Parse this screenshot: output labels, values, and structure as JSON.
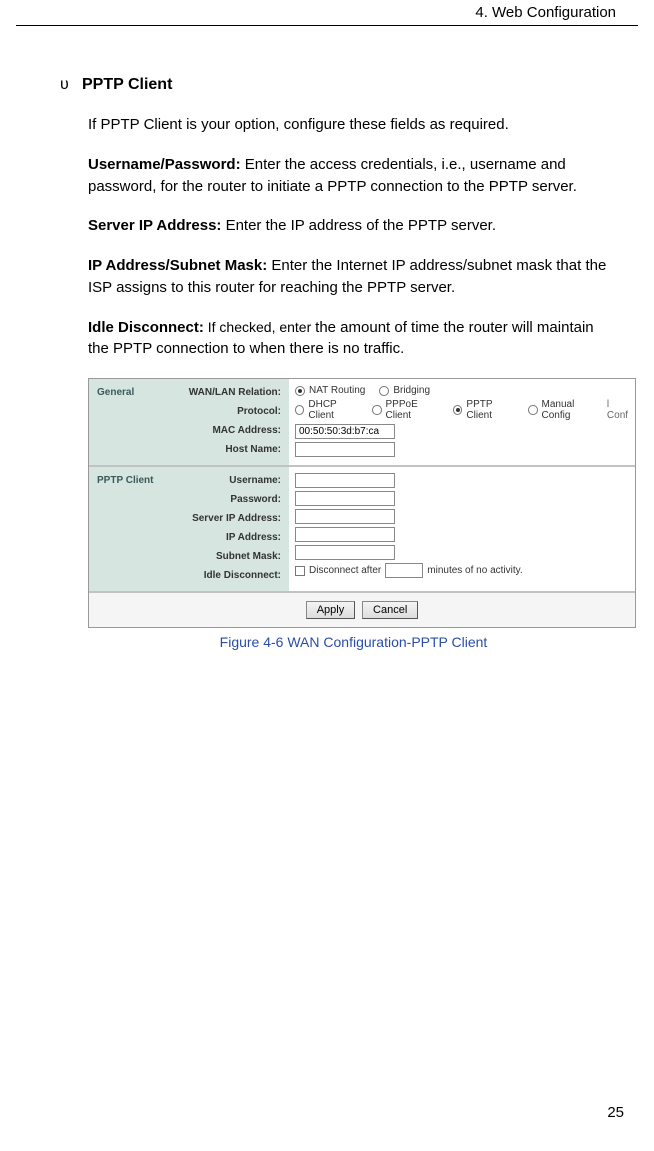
{
  "header": {
    "chapter": "4. Web Configuration"
  },
  "bullet_symbol": "υ",
  "section_title": "PPTP Client",
  "intro": "If PPTP Client is your option, configure these fields as required.",
  "defs": [
    {
      "label": "Username/Password:",
      "text": " Enter the access credentials, i.e., username and password, for the router to initiate a PPTP connection to the PPTP server."
    },
    {
      "label": "Server IP Address:",
      "text": " Enter the IP address of the PPTP server."
    },
    {
      "label": "IP Address/Subnet Mask:",
      "text": " Enter the Internet IP address/subnet mask that the ISP assigns to this router for reaching the PPTP server."
    },
    {
      "label": "Idle Disconnect:",
      "text_prefix": " If checked, enter ",
      "text_main": "the amount of time the router will maintain the PPTP connection to when there is no traffic."
    }
  ],
  "screenshot": {
    "panel1": {
      "name": "General",
      "rows": {
        "wanlan": "WAN/LAN Relation:",
        "protocol": "Protocol:",
        "mac": "MAC Address:",
        "host": "Host Name:"
      },
      "relation_opts": {
        "nat": "NAT Routing",
        "bridging": "Bridging"
      },
      "protocol_opts": {
        "dhcp": "DHCP Client",
        "pppoe": "PPPoE Client",
        "pptp": "PPTP Client",
        "manual": "Manual Config"
      },
      "mac_value": "00:50:50:3d:b7:ca",
      "trunc": "l Conf"
    },
    "panel2": {
      "name": "PPTP Client",
      "rows": {
        "username": "Username:",
        "password": "Password:",
        "server": "Server IP Address:",
        "ip": "IP Address:",
        "subnet": "Subnet Mask:",
        "idle": "Idle Disconnect:"
      },
      "idle_text1": "Disconnect  after",
      "idle_text2": "minutes of no activity."
    },
    "buttons": {
      "apply": "Apply",
      "cancel": "Cancel"
    }
  },
  "caption": "Figure 4-6    WAN Configuration-PPTP Client",
  "page_number": "25"
}
